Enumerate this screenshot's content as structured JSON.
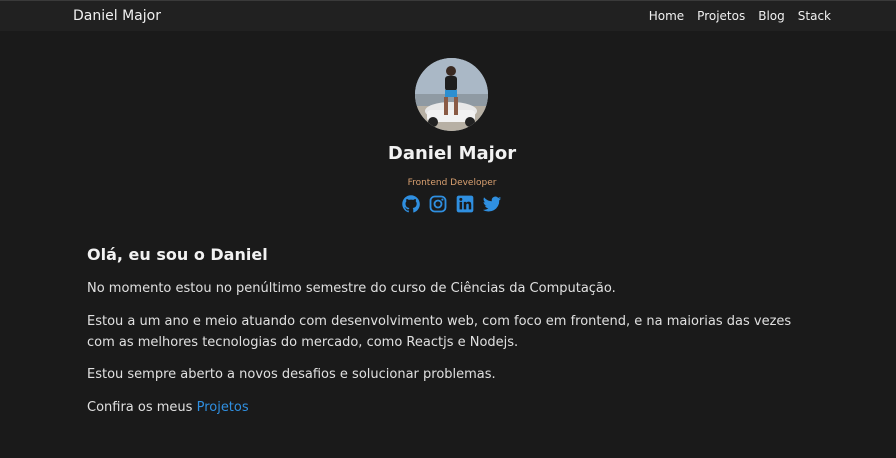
{
  "navbar": {
    "brand": "Daniel Major",
    "links": [
      "Home",
      "Projetos",
      "Blog",
      "Stack"
    ]
  },
  "profile": {
    "name": "Daniel Major",
    "role": "Frontend Developer",
    "socials": [
      "github-icon",
      "instagram-icon",
      "linkedin-icon",
      "twitter-icon"
    ]
  },
  "about": {
    "heading": "Olá, eu sou o Daniel",
    "p1": "No momento estou no penúltimo semestre do curso de Ciências da Computação.",
    "p2": "Estou a um ano e meio atuando com desenvolvimento web, com foco em frontend, e na maiorias das vezes com as melhores tecnologias do mercado, como Reactjs e Nodejs.",
    "p3": "Estou sempre aberto a novos desafios e solucionar problemas.",
    "p4_prefix": "Confira os meus ",
    "p4_link": "Projetos"
  },
  "colors": {
    "background": "#1a1a1a",
    "navbar": "#212121",
    "accent": "#2f8fe0",
    "role": "#d9a070"
  }
}
